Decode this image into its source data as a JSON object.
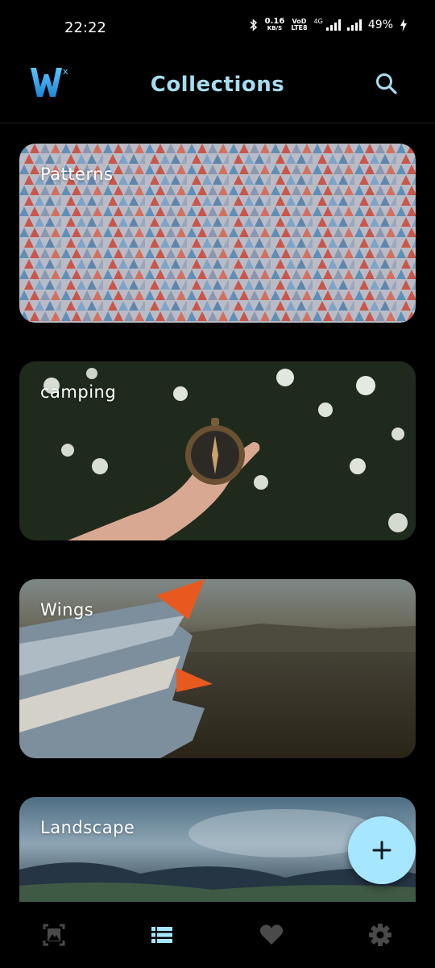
{
  "status_bar": {
    "time": "22:22",
    "net_speed_value": "0.16",
    "net_speed_unit": "KB/S",
    "volte_top": "VoD",
    "volte_bottom": "LTE8",
    "network_type": "4G",
    "battery": "49%",
    "icons": [
      "bluetooth-icon",
      "signal-icon",
      "signal-icon",
      "charging-icon"
    ]
  },
  "header": {
    "title": "Collections",
    "logo_superscript": "x",
    "icons": [
      "app-logo",
      "search-icon"
    ]
  },
  "collections": [
    {
      "label": "Patterns"
    },
    {
      "label": "camping"
    },
    {
      "label": "Wings"
    },
    {
      "label": "Landscape"
    }
  ],
  "fab": {
    "icon": "plus-icon",
    "color": "#a6e6ff"
  },
  "bottom_nav": {
    "items": [
      {
        "icon": "image-icon",
        "active": false
      },
      {
        "icon": "list-icon",
        "active": true
      },
      {
        "icon": "heart-icon",
        "active": false
      },
      {
        "icon": "gear-icon",
        "active": false
      }
    ]
  },
  "colors": {
    "accent": "#a6dcf0",
    "active_nav": "#a6e6ff",
    "inactive_nav": "#4a4a4a",
    "background": "#000000"
  }
}
